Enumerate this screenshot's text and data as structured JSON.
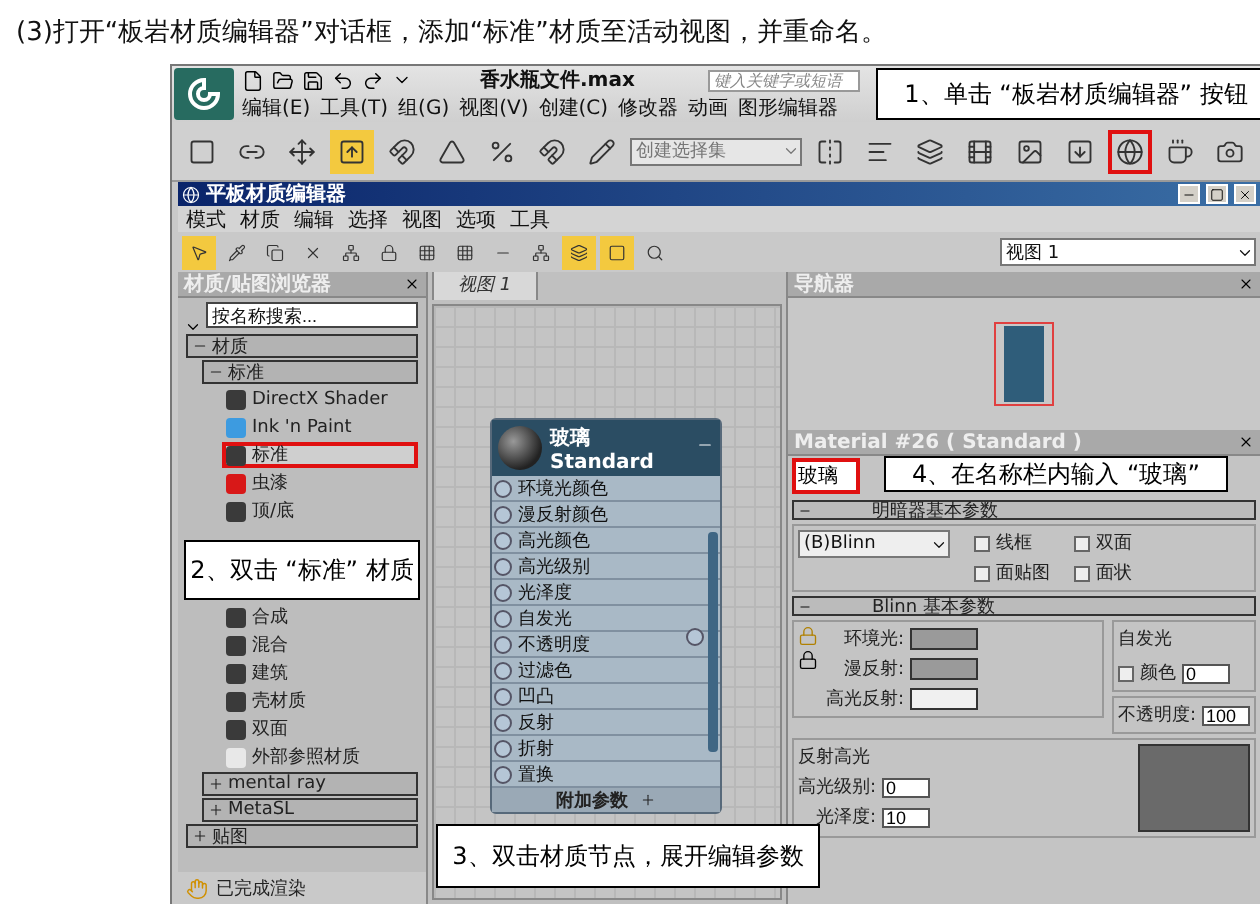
{
  "instruction": "(3)打开“板岩材质编辑器”对话框，添加“标准”材质至活动视图，并重命名。",
  "app": {
    "title": "香水瓶文件.max",
    "search": {
      "placeholder": "键入关键字或短语"
    },
    "menu": [
      "编辑(E)",
      "工具(T)",
      "组(G)",
      "视图(V)",
      "创建(C)",
      "修改器",
      "动画",
      "图形编辑器"
    ],
    "selection_set": "创建选择集",
    "callout": "1、单击 “板岩材质编辑器” 按钮",
    "toolbar": [
      {
        "active": false
      },
      {
        "active": false
      },
      {
        "active": false
      },
      {
        "active": true
      },
      {
        "active": false
      },
      {
        "active": false
      },
      {
        "active": false
      },
      {
        "active": false
      },
      {
        "active": false
      },
      {
        "active": false
      },
      {
        "active": false
      },
      {
        "active": false
      },
      {
        "active": false
      },
      {
        "active": false
      },
      {
        "active": false
      },
      {
        "active": false,
        "highlighted": true
      },
      {
        "active": false
      },
      {
        "active": false
      }
    ]
  },
  "editor": {
    "title": "平板材质编辑器",
    "menu": [
      "模式",
      "材质",
      "编辑",
      "选择",
      "视图",
      "选项",
      "工具"
    ],
    "toolbar": [
      {
        "active": true
      },
      {
        "active": false
      },
      {
        "active": false
      },
      {
        "active": false
      },
      {
        "active": false
      },
      {
        "active": false
      },
      {
        "active": false
      },
      {
        "active": false
      },
      {
        "active": false
      },
      {
        "active": false
      },
      {
        "active": true
      },
      {
        "active": true
      },
      {
        "active": false
      }
    ],
    "view_select": "视图 1",
    "browser": {
      "title": "材质/贴图浏览器",
      "search": {
        "placeholder": "按名称搜索..."
      },
      "groups": [
        {
          "label": "材质",
          "expanded": true,
          "children": [
            {
              "label": "标准",
              "expanded": true,
              "items": [
                {
                  "label": "DirectX Shader",
                  "color": "#3a3a3a",
                  "highlighted": false
                },
                {
                  "label": "Ink 'n Paint",
                  "color": "#3d9be0",
                  "highlighted": false
                },
                {
                  "label": "标准",
                  "color": "#3a3a3a",
                  "highlighted": true
                },
                {
                  "label": "虫漆",
                  "color": "#d81818",
                  "highlighted": false
                },
                {
                  "label": "顶/底",
                  "color": "#3a3a3a",
                  "highlighted": false
                },
                {
                  "label": "合成",
                  "color": "#3a3a3a",
                  "highlighted": false
                },
                {
                  "label": "混合",
                  "color": "#3a3a3a",
                  "highlighted": false
                },
                {
                  "label": "建筑",
                  "color": "#3a3a3a",
                  "highlighted": false
                },
                {
                  "label": "壳材质",
                  "color": "#3a3a3a",
                  "highlighted": false
                },
                {
                  "label": "双面",
                  "color": "#3a3a3a",
                  "highlighted": false
                },
                {
                  "label": "外部参照材质",
                  "color": "#e8e8e8",
                  "highlighted": false
                }
              ]
            },
            {
              "label": "mental ray",
              "expanded": false
            },
            {
              "label": "MetaSL",
              "expanded": false
            }
          ]
        },
        {
          "label": "贴图",
          "expanded": false
        }
      ],
      "callout": "2、双击 “标准” 材质",
      "status": "已完成渲染"
    }
  },
  "view": {
    "tab": "视图 1",
    "node": {
      "title": "玻璃",
      "subtitle": "Standard",
      "slots": [
        "环境光颜色",
        "漫反射颜色",
        "高光颜色",
        "高光级别",
        "光泽度",
        "自发光",
        "不透明度",
        "过滤色",
        "凹凸",
        "反射",
        "折射",
        "置换"
      ],
      "footer": "附加参数"
    },
    "callout": "3、双击材质节点，展开编辑参数"
  },
  "navigator": {
    "title": "导航器"
  },
  "material": {
    "title": "Material #26 ( Standard )",
    "name": {
      "value": "玻璃",
      "highlighted": true
    },
    "callout": "4、在名称栏内输入 “玻璃”",
    "shader_rollout": {
      "title": "明暗器基本参数",
      "shader": "(B)Blinn",
      "options": [
        {
          "label": "线框",
          "checked": false
        },
        {
          "label": "双面",
          "checked": false
        },
        {
          "label": "面贴图",
          "checked": false
        },
        {
          "label": "面状",
          "checked": false
        }
      ]
    },
    "blinn_rollout": {
      "title": "Blinn 基本参数",
      "colors": [
        {
          "label": "环境光:",
          "color": "#9a9a9a"
        },
        {
          "label": "漫反射:",
          "color": "#9a9a9a"
        },
        {
          "label": "高光反射:",
          "color": "#f0f0f0"
        }
      ],
      "self_illum": {
        "title": "自发光",
        "label": "颜色",
        "checked": false,
        "value": "0"
      },
      "opacity": {
        "label": "不透明度:",
        "value": "100"
      }
    },
    "highlights": {
      "title": "反射高光",
      "specular_level": {
        "label": "高光级别:",
        "value": "0"
      },
      "glossiness": {
        "label": "光泽度:",
        "value": "10"
      }
    }
  }
}
